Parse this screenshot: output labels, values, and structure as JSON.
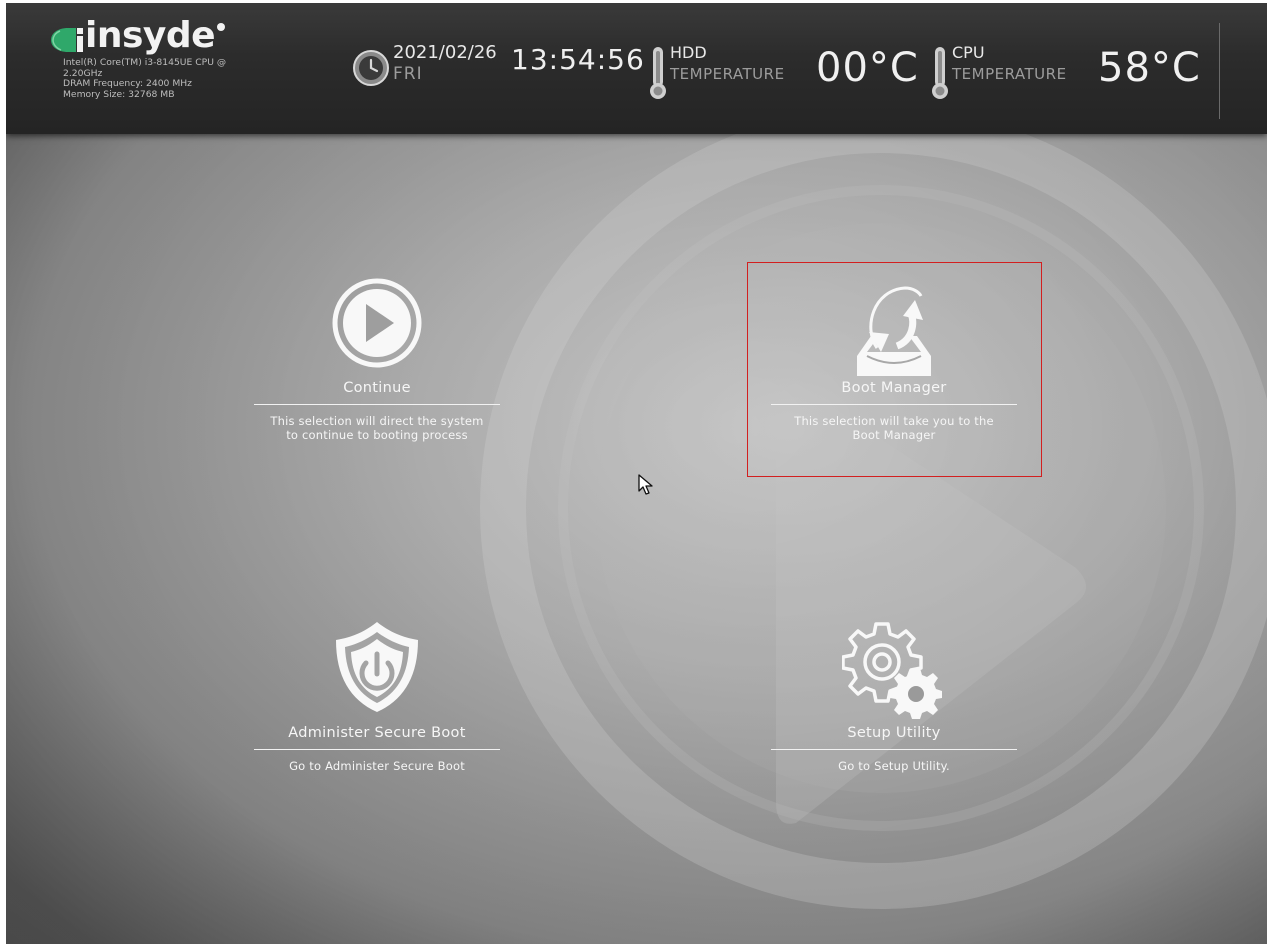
{
  "header": {
    "brand": "insyde",
    "sysinfo": [
      "Intel(R) Core(TM) i3-8145UE CPU @",
      "2.20GHz",
      "DRAM Frequency: 2400 MHz",
      "Memory Size: 32768 MB"
    ],
    "date": "2021/02/26",
    "day": "FRI",
    "time": "13:54:56",
    "hdd": {
      "name": "HDD",
      "label": "TEMPERATURE",
      "value": "00°C"
    },
    "cpu": {
      "name": "CPU",
      "label": "TEMPERATURE",
      "value": "58°C"
    }
  },
  "menu": [
    {
      "id": "continue",
      "icon": "play-circle-icon",
      "title": "Continue",
      "description_lines": [
        "This selection will direct the system",
        "to continue to booting process"
      ]
    },
    {
      "id": "boot-manager",
      "icon": "boot-manager-icon",
      "title": "Boot Manager",
      "description_lines": [
        "This selection will take you to the",
        "Boot Manager"
      ],
      "selected": true
    },
    {
      "id": "administer-secure-boot",
      "icon": "shield-power-icon",
      "title": "Administer Secure Boot",
      "description_lines": [
        "Go to Administer Secure Boot"
      ]
    },
    {
      "id": "setup-utility",
      "icon": "gears-icon",
      "title": "Setup Utility",
      "description_lines": [
        "Go to Setup Utility."
      ]
    }
  ],
  "colors": {
    "selection_border": "#d21f1f",
    "logo_accent": "#2fa86a",
    "header_bg": "#2c2c2c"
  }
}
